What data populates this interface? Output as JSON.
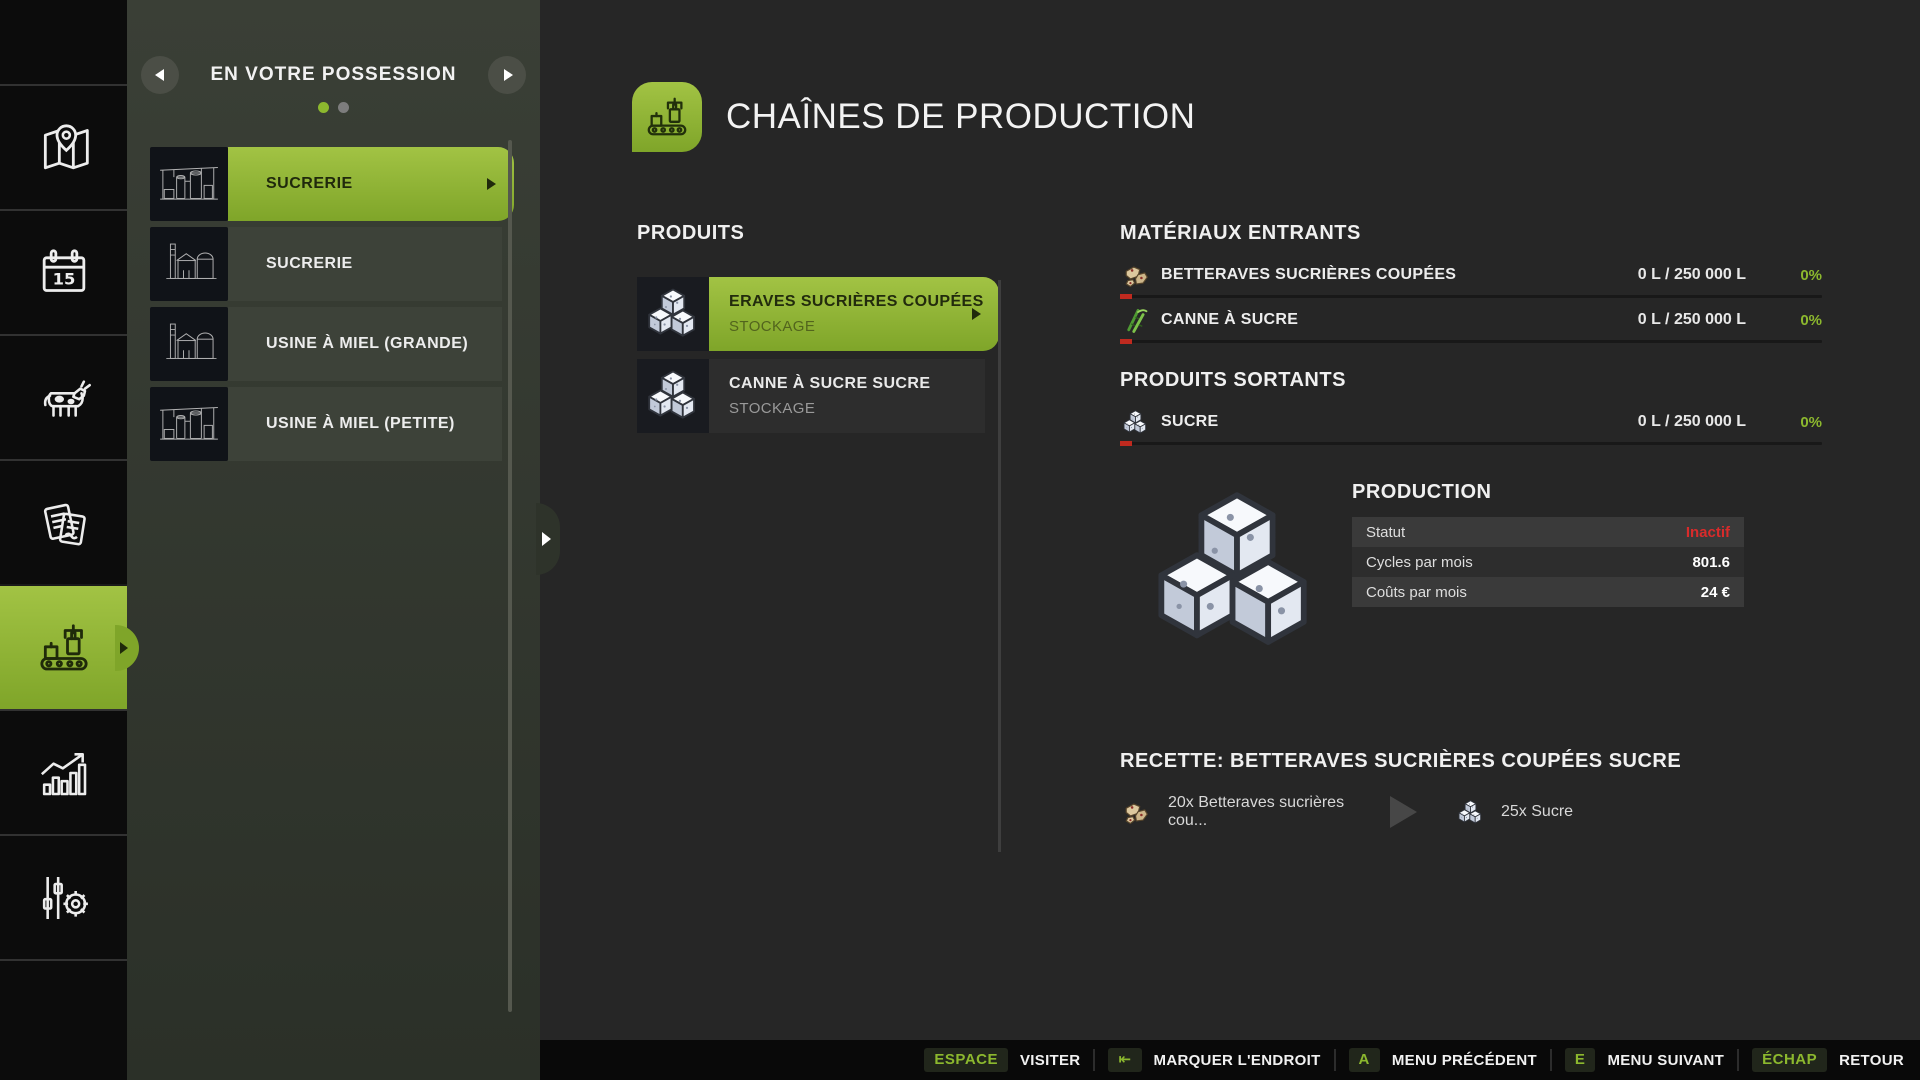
{
  "colors": {
    "accent": "#8cb82e",
    "accent-light": "#a2c344",
    "accent-dark": "#7fa529",
    "status-red": "#d92b2b",
    "sidebar-bg": "#0c0c0c",
    "panel-bg": "#31362d",
    "main-bg": "#262626",
    "hotbar-bg": "#090909"
  },
  "sidebar": {
    "items": [
      {
        "name": "map",
        "icon": "map-icon",
        "active": false
      },
      {
        "name": "calendar",
        "icon": "calendar-icon",
        "active": false
      },
      {
        "name": "animals",
        "icon": "cow-icon",
        "active": false
      },
      {
        "name": "contracts",
        "icon": "contracts-icon",
        "active": false
      },
      {
        "name": "production-chains",
        "icon": "production-icon",
        "active": true
      },
      {
        "name": "statistics",
        "icon": "stats-icon",
        "active": false
      },
      {
        "name": "finances",
        "icon": "finance-sliders-icon",
        "active": false
      }
    ]
  },
  "ownership_panel": {
    "title": "EN VOTRE POSSESSION",
    "page_count": 2,
    "active_page": 0,
    "buildings": [
      {
        "label": "SUCRERIE",
        "selected": true,
        "thumb": "refinery"
      },
      {
        "label": "SUCRERIE",
        "selected": false,
        "thumb": "factory"
      },
      {
        "label": "USINE À MIEL (GRANDE)",
        "selected": false,
        "thumb": "factory"
      },
      {
        "label": "USINE À MIEL (PETITE)",
        "selected": false,
        "thumb": "refinery"
      }
    ]
  },
  "header": {
    "title": "CHAÎNES DE PRODUCTION",
    "icon": "production-icon"
  },
  "products": {
    "title": "PRODUITS",
    "items": [
      {
        "line1": "ERAVES SUCRIÈRES COUPÉES",
        "line2": "STOCKAGE",
        "selected": true,
        "icon": "sugar-cubes-icon"
      },
      {
        "line1": "CANNE À SUCRE SUCRE",
        "line2": "STOCKAGE",
        "selected": false,
        "icon": "sugar-cubes-icon"
      }
    ]
  },
  "inputs": {
    "title": "MATÉRIAUX ENTRANTS",
    "rows": [
      {
        "icon": "beet-chunks-icon",
        "label": "BETTERAVES SUCRIÈRES COUPÉES",
        "amount": "0 L / 250 000 L",
        "percent": "0%",
        "fill": 0
      },
      {
        "icon": "sugarcane-icon",
        "label": "CANNE À SUCRE",
        "amount": "0 L / 250 000 L",
        "percent": "0%",
        "fill": 0
      }
    ]
  },
  "outputs": {
    "title": "PRODUITS SORTANTS",
    "rows": [
      {
        "icon": "sugar-cubes-icon",
        "label": "SUCRE",
        "amount": "0 L / 250 000 L",
        "percent": "0%",
        "fill": 0
      }
    ]
  },
  "production": {
    "title": "PRODUCTION",
    "rows": [
      {
        "label": "Statut",
        "value": "Inactif",
        "status": "inactive"
      },
      {
        "label": "Cycles par mois",
        "value": "801.6"
      },
      {
        "label": "Coûts par mois",
        "value": "24 €"
      }
    ]
  },
  "recipe": {
    "title": "RECETTE: BETTERAVES SUCRIÈRES COUPÉES SUCRE",
    "input_text": "20x Betteraves sucrières cou...",
    "output_text": "25x Sucre"
  },
  "hotbar": {
    "hints": [
      {
        "key": "ESPACE",
        "label": "VISITER"
      },
      {
        "key": "⇤",
        "label": "MARQUER L'ENDROIT"
      },
      {
        "key": "A",
        "label": "MENU PRÉCÉDENT"
      },
      {
        "key": "E",
        "label": "MENU SUIVANT"
      },
      {
        "key": "ÉCHAP",
        "label": "RETOUR"
      }
    ]
  }
}
